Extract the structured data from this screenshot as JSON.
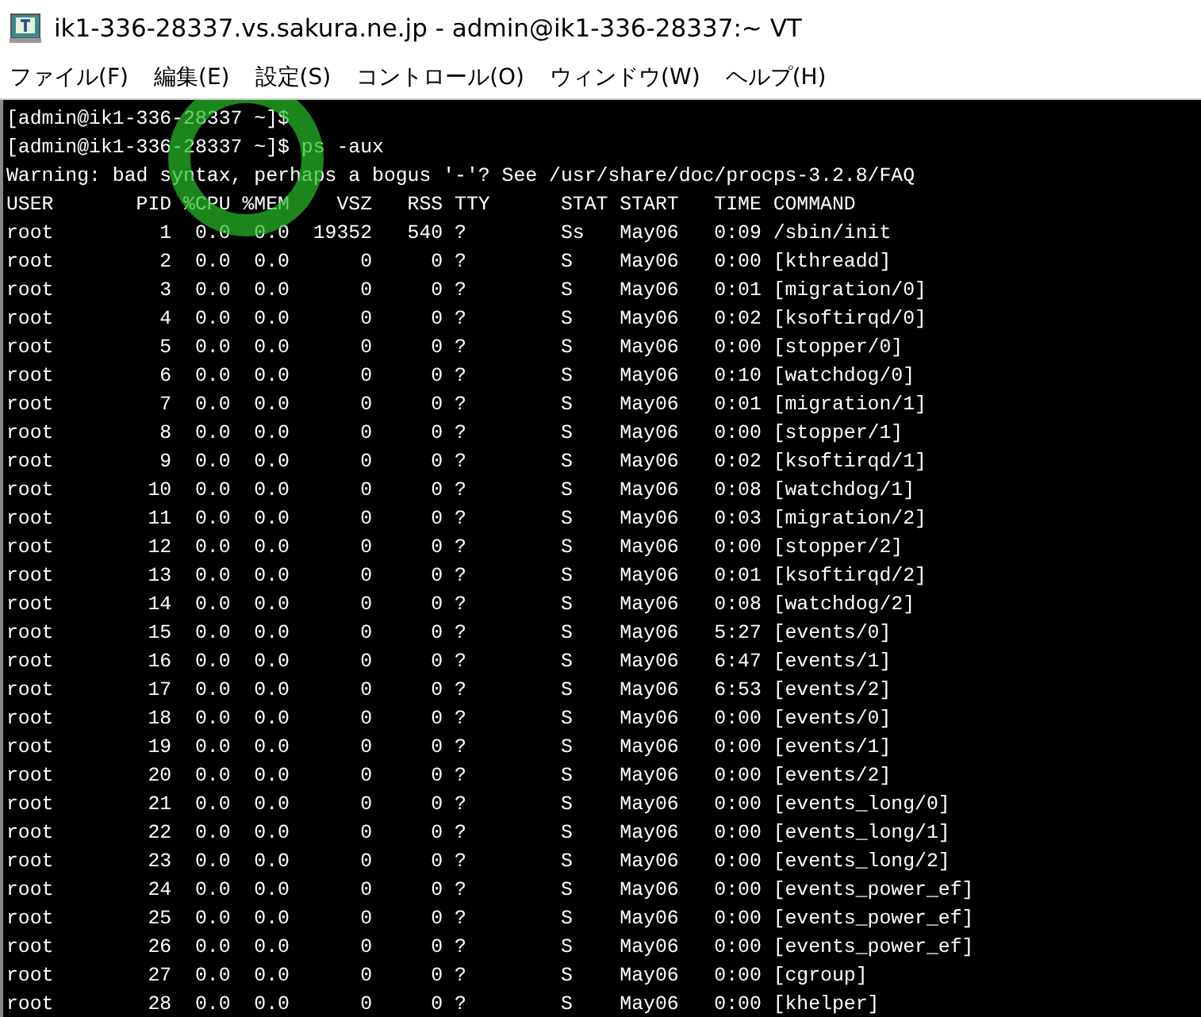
{
  "window": {
    "title": "ik1-336-28337.vs.sakura.ne.jp - admin@ik1-336-28337:~ VT"
  },
  "menu": [
    "ファイル(F)",
    "編集(E)",
    "設定(S)",
    "コントロール(O)",
    "ウィンドウ(W)",
    "ヘルプ(H)"
  ],
  "terminal": {
    "lines": [
      "[admin@ik1-336-28337 ~]$",
      "[admin@ik1-336-28337 ~]$ ps -aux",
      "Warning: bad syntax, perhaps a bogus '-'? See /usr/share/doc/procps-3.2.8/FAQ",
      "USER       PID %CPU %MEM    VSZ   RSS TTY      STAT START   TIME COMMAND",
      "root         1  0.0  0.0  19352   540 ?        Ss   May06   0:09 /sbin/init",
      "root         2  0.0  0.0      0     0 ?        S    May06   0:00 [kthreadd]",
      "root         3  0.0  0.0      0     0 ?        S    May06   0:01 [migration/0]",
      "root         4  0.0  0.0      0     0 ?        S    May06   0:02 [ksoftirqd/0]",
      "root         5  0.0  0.0      0     0 ?        S    May06   0:00 [stopper/0]",
      "root         6  0.0  0.0      0     0 ?        S    May06   0:10 [watchdog/0]",
      "root         7  0.0  0.0      0     0 ?        S    May06   0:01 [migration/1]",
      "root         8  0.0  0.0      0     0 ?        S    May06   0:00 [stopper/1]",
      "root         9  0.0  0.0      0     0 ?        S    May06   0:02 [ksoftirqd/1]",
      "root        10  0.0  0.0      0     0 ?        S    May06   0:08 [watchdog/1]",
      "root        11  0.0  0.0      0     0 ?        S    May06   0:03 [migration/2]",
      "root        12  0.0  0.0      0     0 ?        S    May06   0:00 [stopper/2]",
      "root        13  0.0  0.0      0     0 ?        S    May06   0:01 [ksoftirqd/2]",
      "root        14  0.0  0.0      0     0 ?        S    May06   0:08 [watchdog/2]",
      "root        15  0.0  0.0      0     0 ?        S    May06   5:27 [events/0]",
      "root        16  0.0  0.0      0     0 ?        S    May06   6:47 [events/1]",
      "root        17  0.0  0.0      0     0 ?        S    May06   6:53 [events/2]",
      "root        18  0.0  0.0      0     0 ?        S    May06   0:00 [events/0]",
      "root        19  0.0  0.0      0     0 ?        S    May06   0:00 [events/1]",
      "root        20  0.0  0.0      0     0 ?        S    May06   0:00 [events/2]",
      "root        21  0.0  0.0      0     0 ?        S    May06   0:00 [events_long/0]",
      "root        22  0.0  0.0      0     0 ?        S    May06   0:00 [events_long/1]",
      "root        23  0.0  0.0      0     0 ?        S    May06   0:00 [events_long/2]",
      "root        24  0.0  0.0      0     0 ?        S    May06   0:00 [events_power_ef]",
      "root        25  0.0  0.0      0     0 ?        S    May06   0:00 [events_power_ef]",
      "root        26  0.0  0.0      0     0 ?        S    May06   0:00 [events_power_ef]",
      "root        27  0.0  0.0      0     0 ?        S    May06   0:00 [cgroup]",
      "root        28  0.0  0.0      0     0 ?        S    May06   0:00 [khelper]"
    ]
  }
}
